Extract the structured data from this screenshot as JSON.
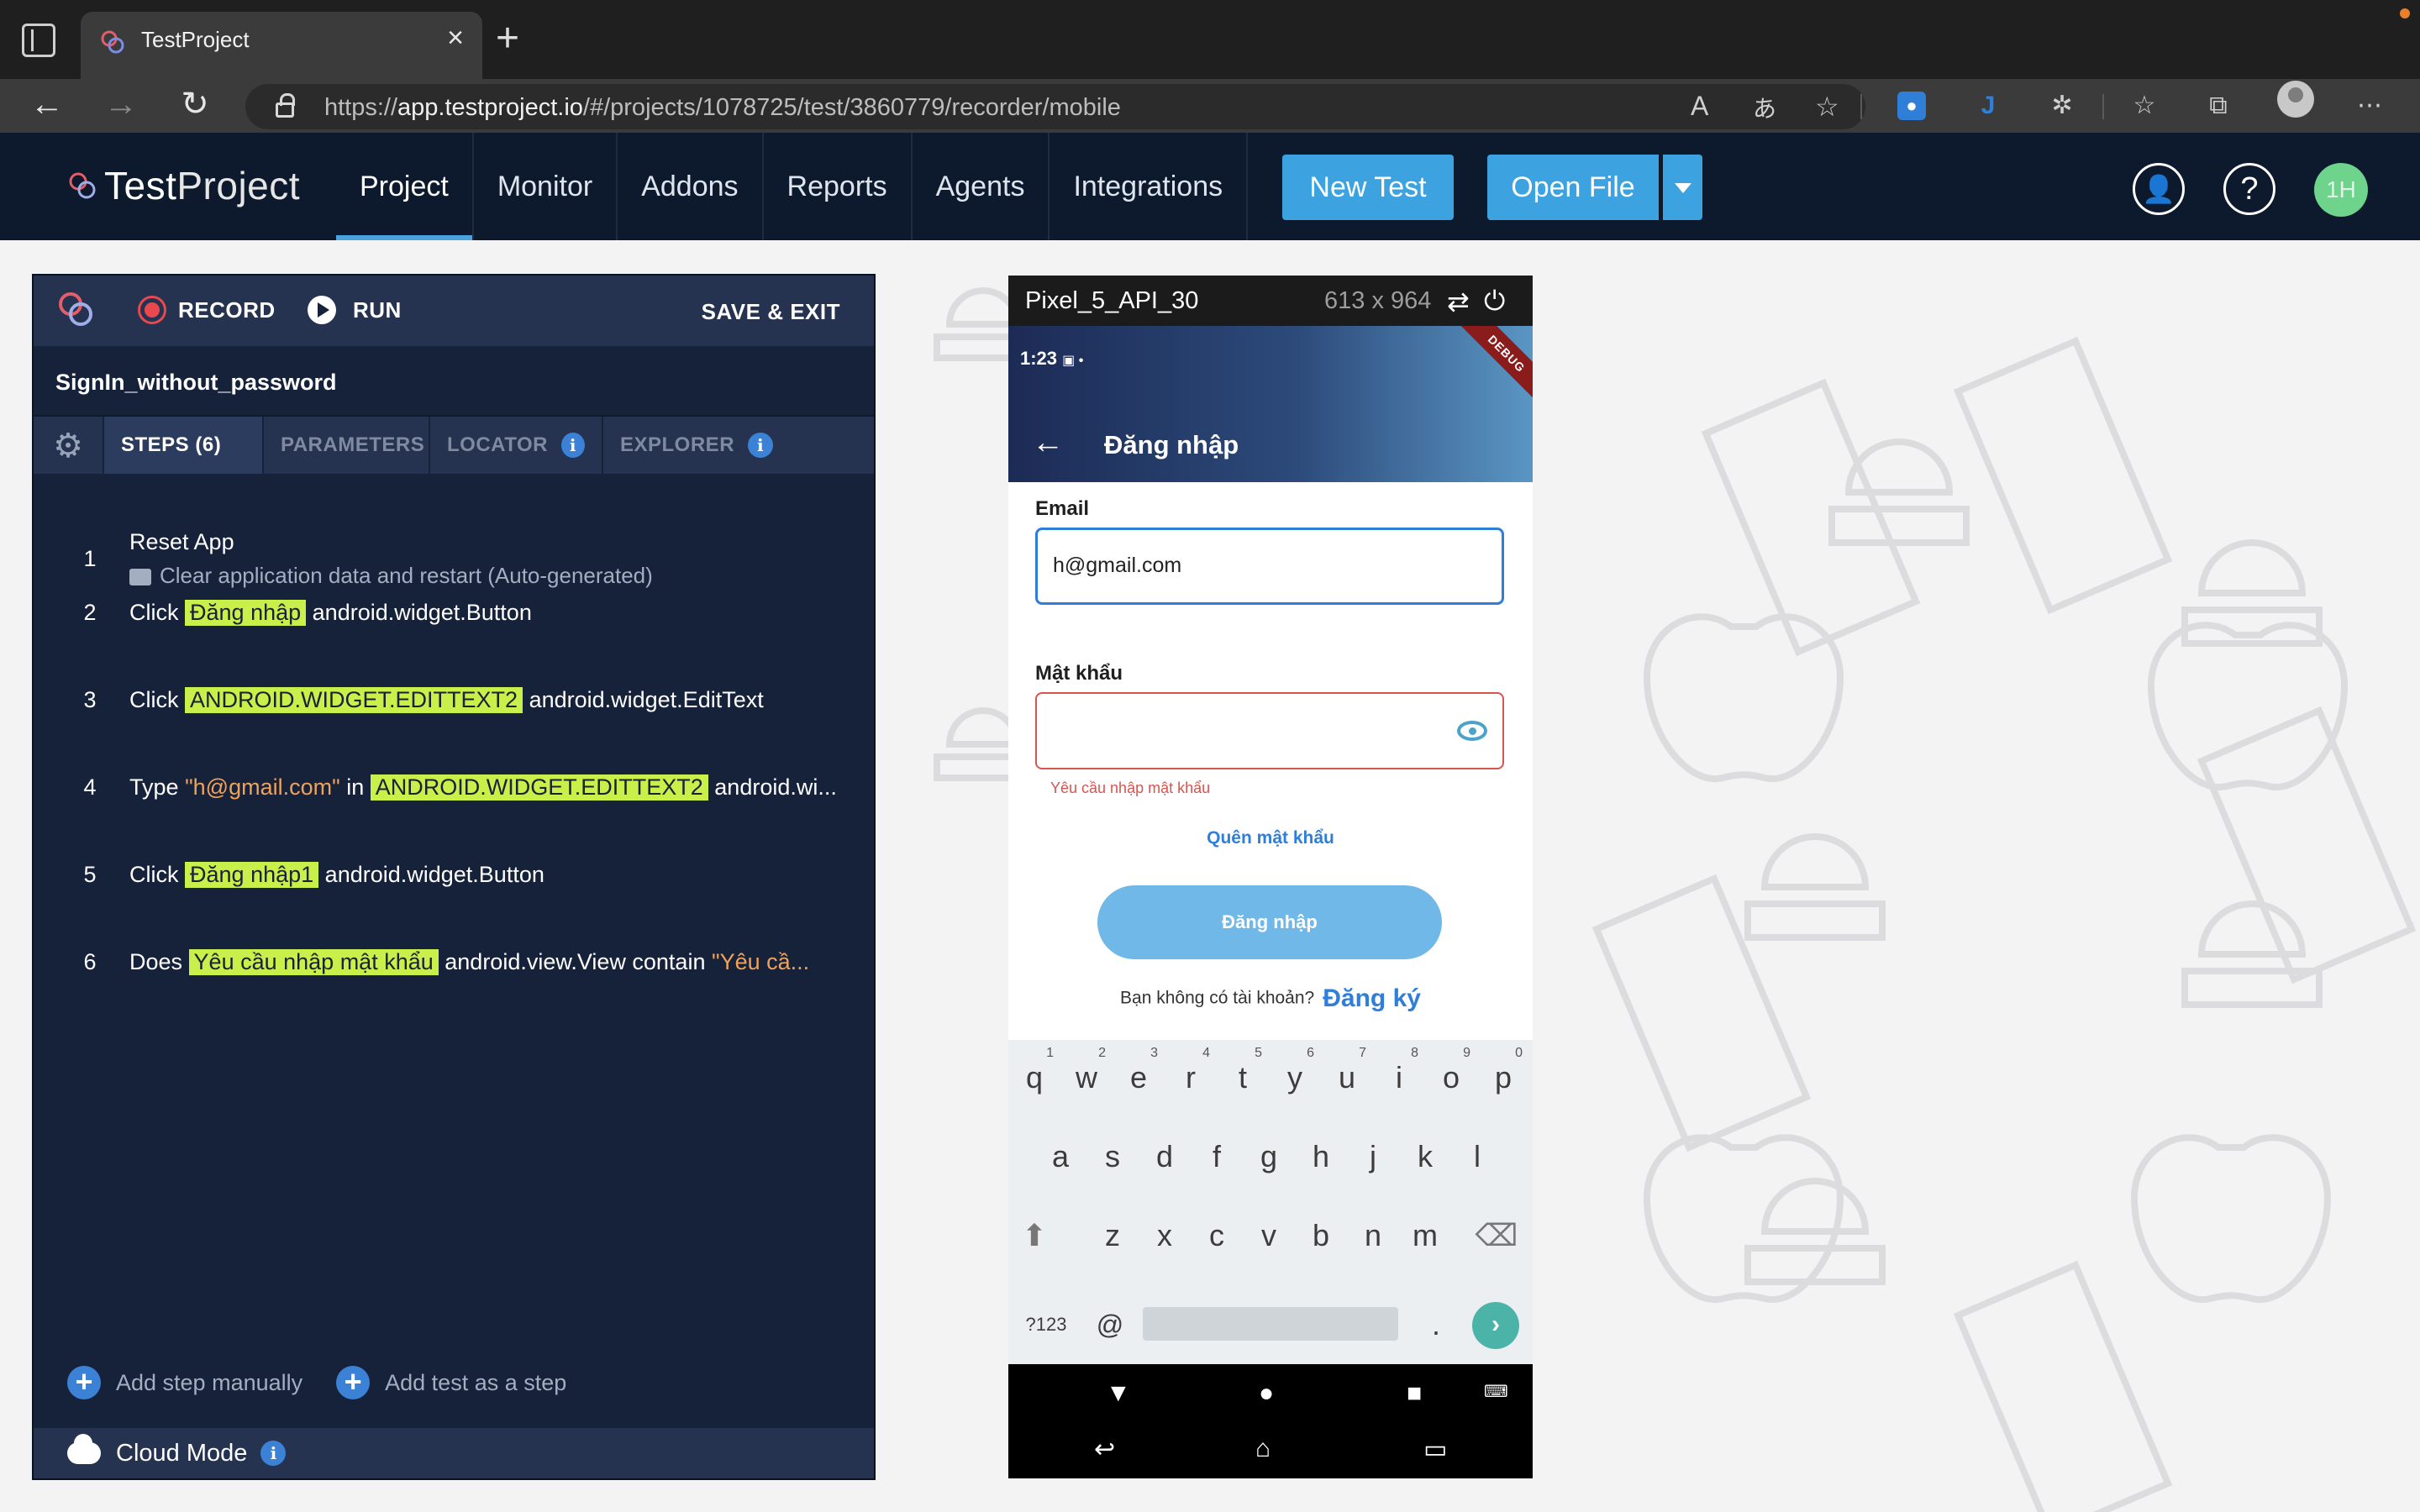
{
  "browser": {
    "tab_title": "TestProject",
    "url_prefix": "https://",
    "url_host": "app.testproject.io",
    "url_path": "/#/projects/1078725/test/3860779/recorder/mobile"
  },
  "app": {
    "logo_test": "Test",
    "logo_project": "Project",
    "nav": [
      "Project",
      "Monitor",
      "Addons",
      "Reports",
      "Agents",
      "Integrations"
    ],
    "new_test": "New Test",
    "open_file": "Open File",
    "user_initials": "1H"
  },
  "recorder": {
    "record": "RECORD",
    "run": "RUN",
    "save_exit": "SAVE & EXIT",
    "test_name": "SignIn_without_password",
    "tabs": {
      "steps": "STEPS (6)",
      "parameters": "PARAMETERS",
      "locator": "LOCATOR",
      "explorer": "EXPLORER"
    },
    "steps": [
      {
        "num": "1",
        "pre": "Reset App",
        "sub": "Clear application data and restart (Auto-generated)"
      },
      {
        "num": "2",
        "pre": "Click",
        "hl": "Đăng nhập",
        "post": "android.widget.Button"
      },
      {
        "num": "3",
        "pre": "Click",
        "hl": "ANDROID.WIDGET.EDITTEXT2",
        "post": "android.widget.EditText"
      },
      {
        "num": "4",
        "pre": "Type",
        "str": "\"h@gmail.com\"",
        "mid": "in",
        "hl": "ANDROID.WIDGET.EDITTEXT2",
        "post": "android.wi..."
      },
      {
        "num": "5",
        "pre": "Click",
        "hl": "Đăng nhập1",
        "post": "android.widget.Button"
      },
      {
        "num": "6",
        "pre": "Does",
        "hl": "Yêu cầu nhập mật khẩu",
        "post": "android.view.View contain",
        "str": "\"Yêu cầ..."
      }
    ],
    "add_manual": "Add step manually",
    "add_test": "Add test as a step",
    "cloud_mode": "Cloud Mode"
  },
  "device": {
    "name": "Pixel_5_API_30",
    "resolution": "613 x 964",
    "time": "1:23",
    "debug_label": "DEBUG",
    "screen_title": "Đăng nhập",
    "email_label": "Email",
    "email_value": "h@gmail.com",
    "password_label": "Mật khẩu",
    "password_error": "Yêu cầu nhập mật khẩu",
    "forgot": "Quên mật khẩu",
    "login_button": "Đăng nhập",
    "no_account": "Bạn không có tài khoản?",
    "signup": "Đăng ký",
    "keyboard": {
      "row1": [
        "q",
        "w",
        "e",
        "r",
        "t",
        "y",
        "u",
        "i",
        "o",
        "p"
      ],
      "row1_digits": [
        "1",
        "2",
        "3",
        "4",
        "5",
        "6",
        "7",
        "8",
        "9",
        "0"
      ],
      "row2": [
        "a",
        "s",
        "d",
        "f",
        "g",
        "h",
        "j",
        "k",
        "l"
      ],
      "row3": [
        "z",
        "x",
        "c",
        "v",
        "b",
        "n",
        "m"
      ],
      "symbols": "?123",
      "at": "@",
      "dot": "."
    }
  },
  "colors": {
    "app_header": "#0d1a2e",
    "accent": "#3da3e0",
    "highlight": "#c9ef4a",
    "string": "#f0a25b",
    "error": "#d9534f"
  }
}
